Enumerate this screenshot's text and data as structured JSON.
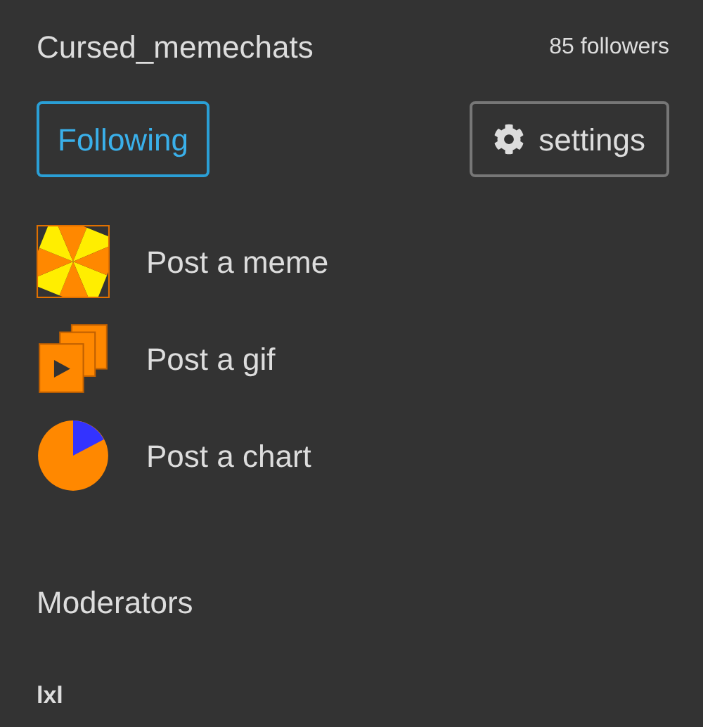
{
  "header": {
    "title": "Cursed_memechats",
    "followers": "85 followers"
  },
  "follow_button": {
    "label": "Following",
    "on": true
  },
  "settings_button": {
    "label": "settings"
  },
  "actions": [
    {
      "kind": "meme",
      "label": "Post a meme"
    },
    {
      "kind": "gif",
      "label": "Post a gif"
    },
    {
      "kind": "chart",
      "label": "Post a chart"
    }
  ],
  "moderators": {
    "heading": "Moderators",
    "names": [
      "lxl"
    ]
  }
}
